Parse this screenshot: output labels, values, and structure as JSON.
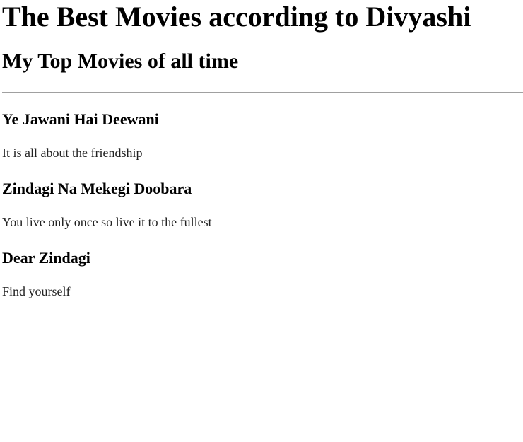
{
  "page": {
    "title": "The Best Movies according to Divyashi",
    "subtitle": "My Top Movies of all time"
  },
  "movies": [
    {
      "title": "Ye Jawani Hai Deewani",
      "description": "It is all about the friendship"
    },
    {
      "title": "Zindagi Na Mekegi Doobara",
      "description": "You live only once so live it to the fullest"
    },
    {
      "title": "Dear Zindagi",
      "description": "Find yourself"
    }
  ]
}
